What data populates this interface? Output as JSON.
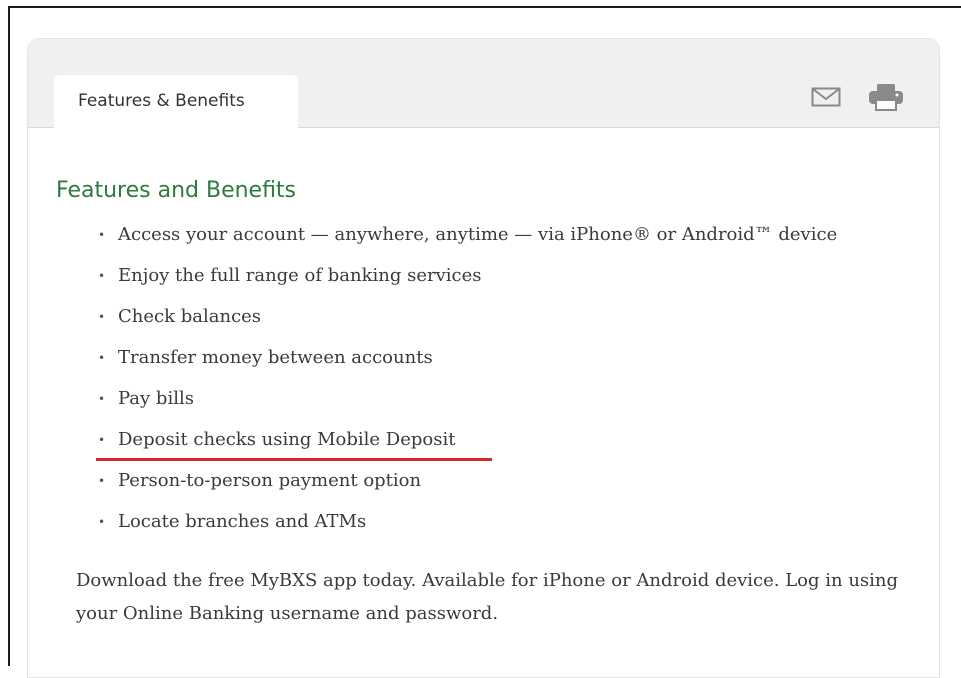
{
  "tab": {
    "label": "Features & Benefits"
  },
  "icons": {
    "email": "envelope-icon",
    "print": "printer-icon"
  },
  "section": {
    "title": "Features and Benefits"
  },
  "features": [
    "Access your account — anywhere, anytime — via iPhone® or Android™ device",
    "Enjoy the full range of banking services",
    "Check balances",
    "Transfer money between accounts",
    "Pay bills",
    "Deposit checks using Mobile Deposit",
    "Person-to-person payment option",
    "Locate branches and ATMs"
  ],
  "highlighted_feature": "Deposit checks using Mobile Deposit",
  "note": "Download the free MyBXS app today. Available for iPhone or Android device. Log in using your Online Banking username and password.",
  "colors": {
    "heading": "#2e7a3e",
    "highlight_underline": "#d9262a",
    "header_bg": "#f0f0f0",
    "icon": "#8a8a8a"
  }
}
